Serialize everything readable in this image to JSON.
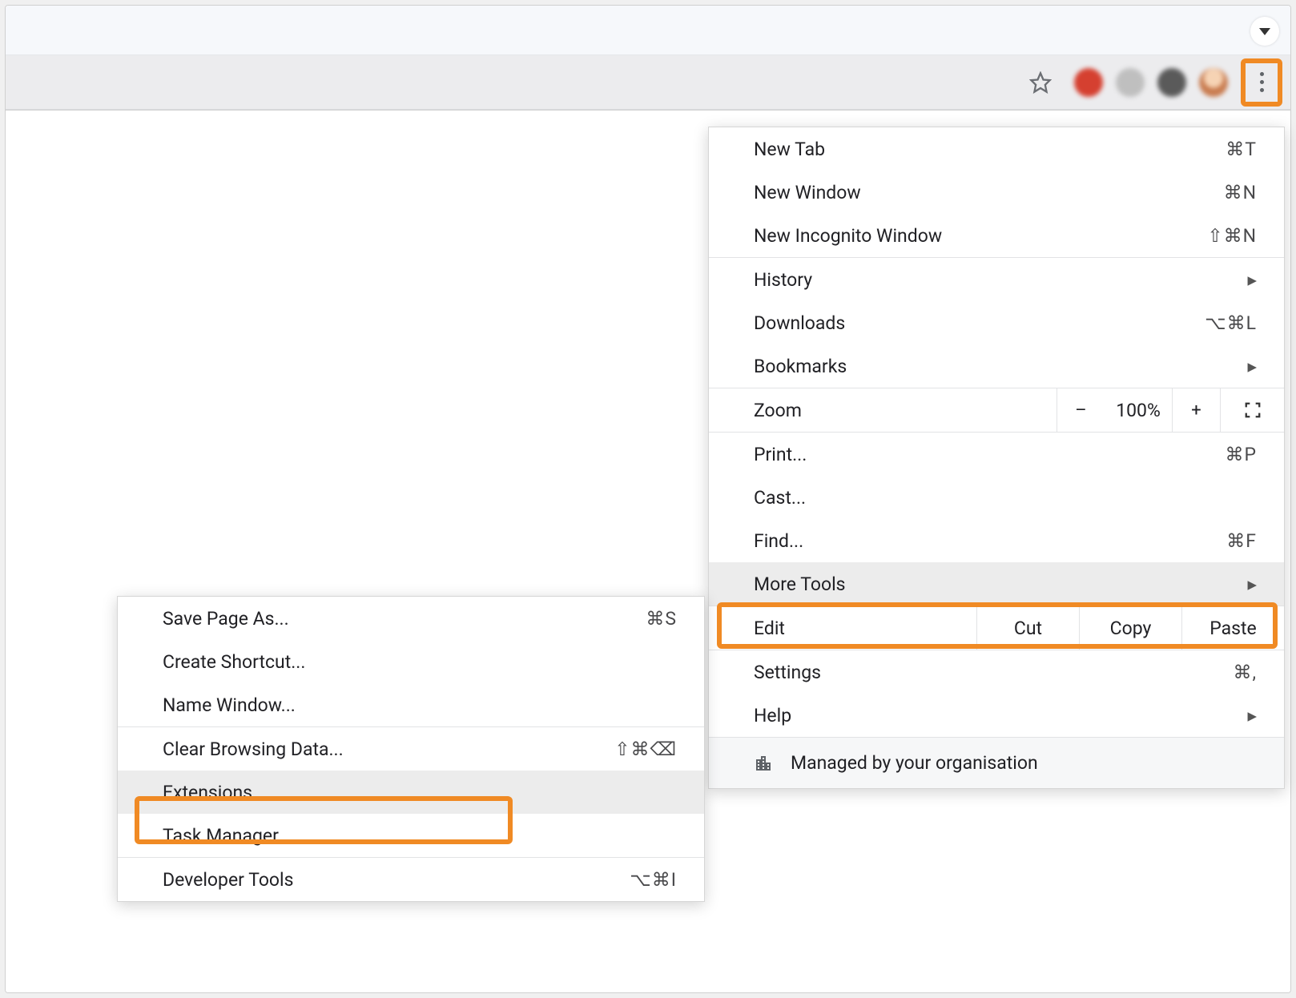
{
  "main_menu": {
    "new_tab": {
      "label": "New Tab",
      "shortcut": "⌘T"
    },
    "new_window": {
      "label": "New Window",
      "shortcut": "⌘N"
    },
    "new_incognito": {
      "label": "New Incognito Window",
      "shortcut": "⇧⌘N"
    },
    "history": {
      "label": "History"
    },
    "downloads": {
      "label": "Downloads",
      "shortcut": "⌥⌘L"
    },
    "bookmarks": {
      "label": "Bookmarks"
    },
    "zoom": {
      "label": "Zoom",
      "minus": "–",
      "value": "100%",
      "plus": "+"
    },
    "print": {
      "label": "Print...",
      "shortcut": "⌘P"
    },
    "cast": {
      "label": "Cast..."
    },
    "find": {
      "label": "Find...",
      "shortcut": "⌘F"
    },
    "more_tools": {
      "label": "More Tools"
    },
    "edit": {
      "label": "Edit",
      "cut": "Cut",
      "copy": "Copy",
      "paste": "Paste"
    },
    "settings": {
      "label": "Settings",
      "shortcut": "⌘,"
    },
    "help": {
      "label": "Help"
    },
    "managed": {
      "label": "Managed by your organisation"
    }
  },
  "sub_menu": {
    "save_page": {
      "label": "Save Page As...",
      "shortcut": "⌘S"
    },
    "create_shortcut": {
      "label": "Create Shortcut..."
    },
    "name_window": {
      "label": "Name Window..."
    },
    "clear_browsing": {
      "label": "Clear Browsing Data...",
      "shortcut": "⇧⌘⌫"
    },
    "extensions": {
      "label": "Extensions"
    },
    "task_manager": {
      "label": "Task Manager"
    },
    "developer_tools": {
      "label": "Developer Tools",
      "shortcut": "⌥⌘I"
    }
  }
}
